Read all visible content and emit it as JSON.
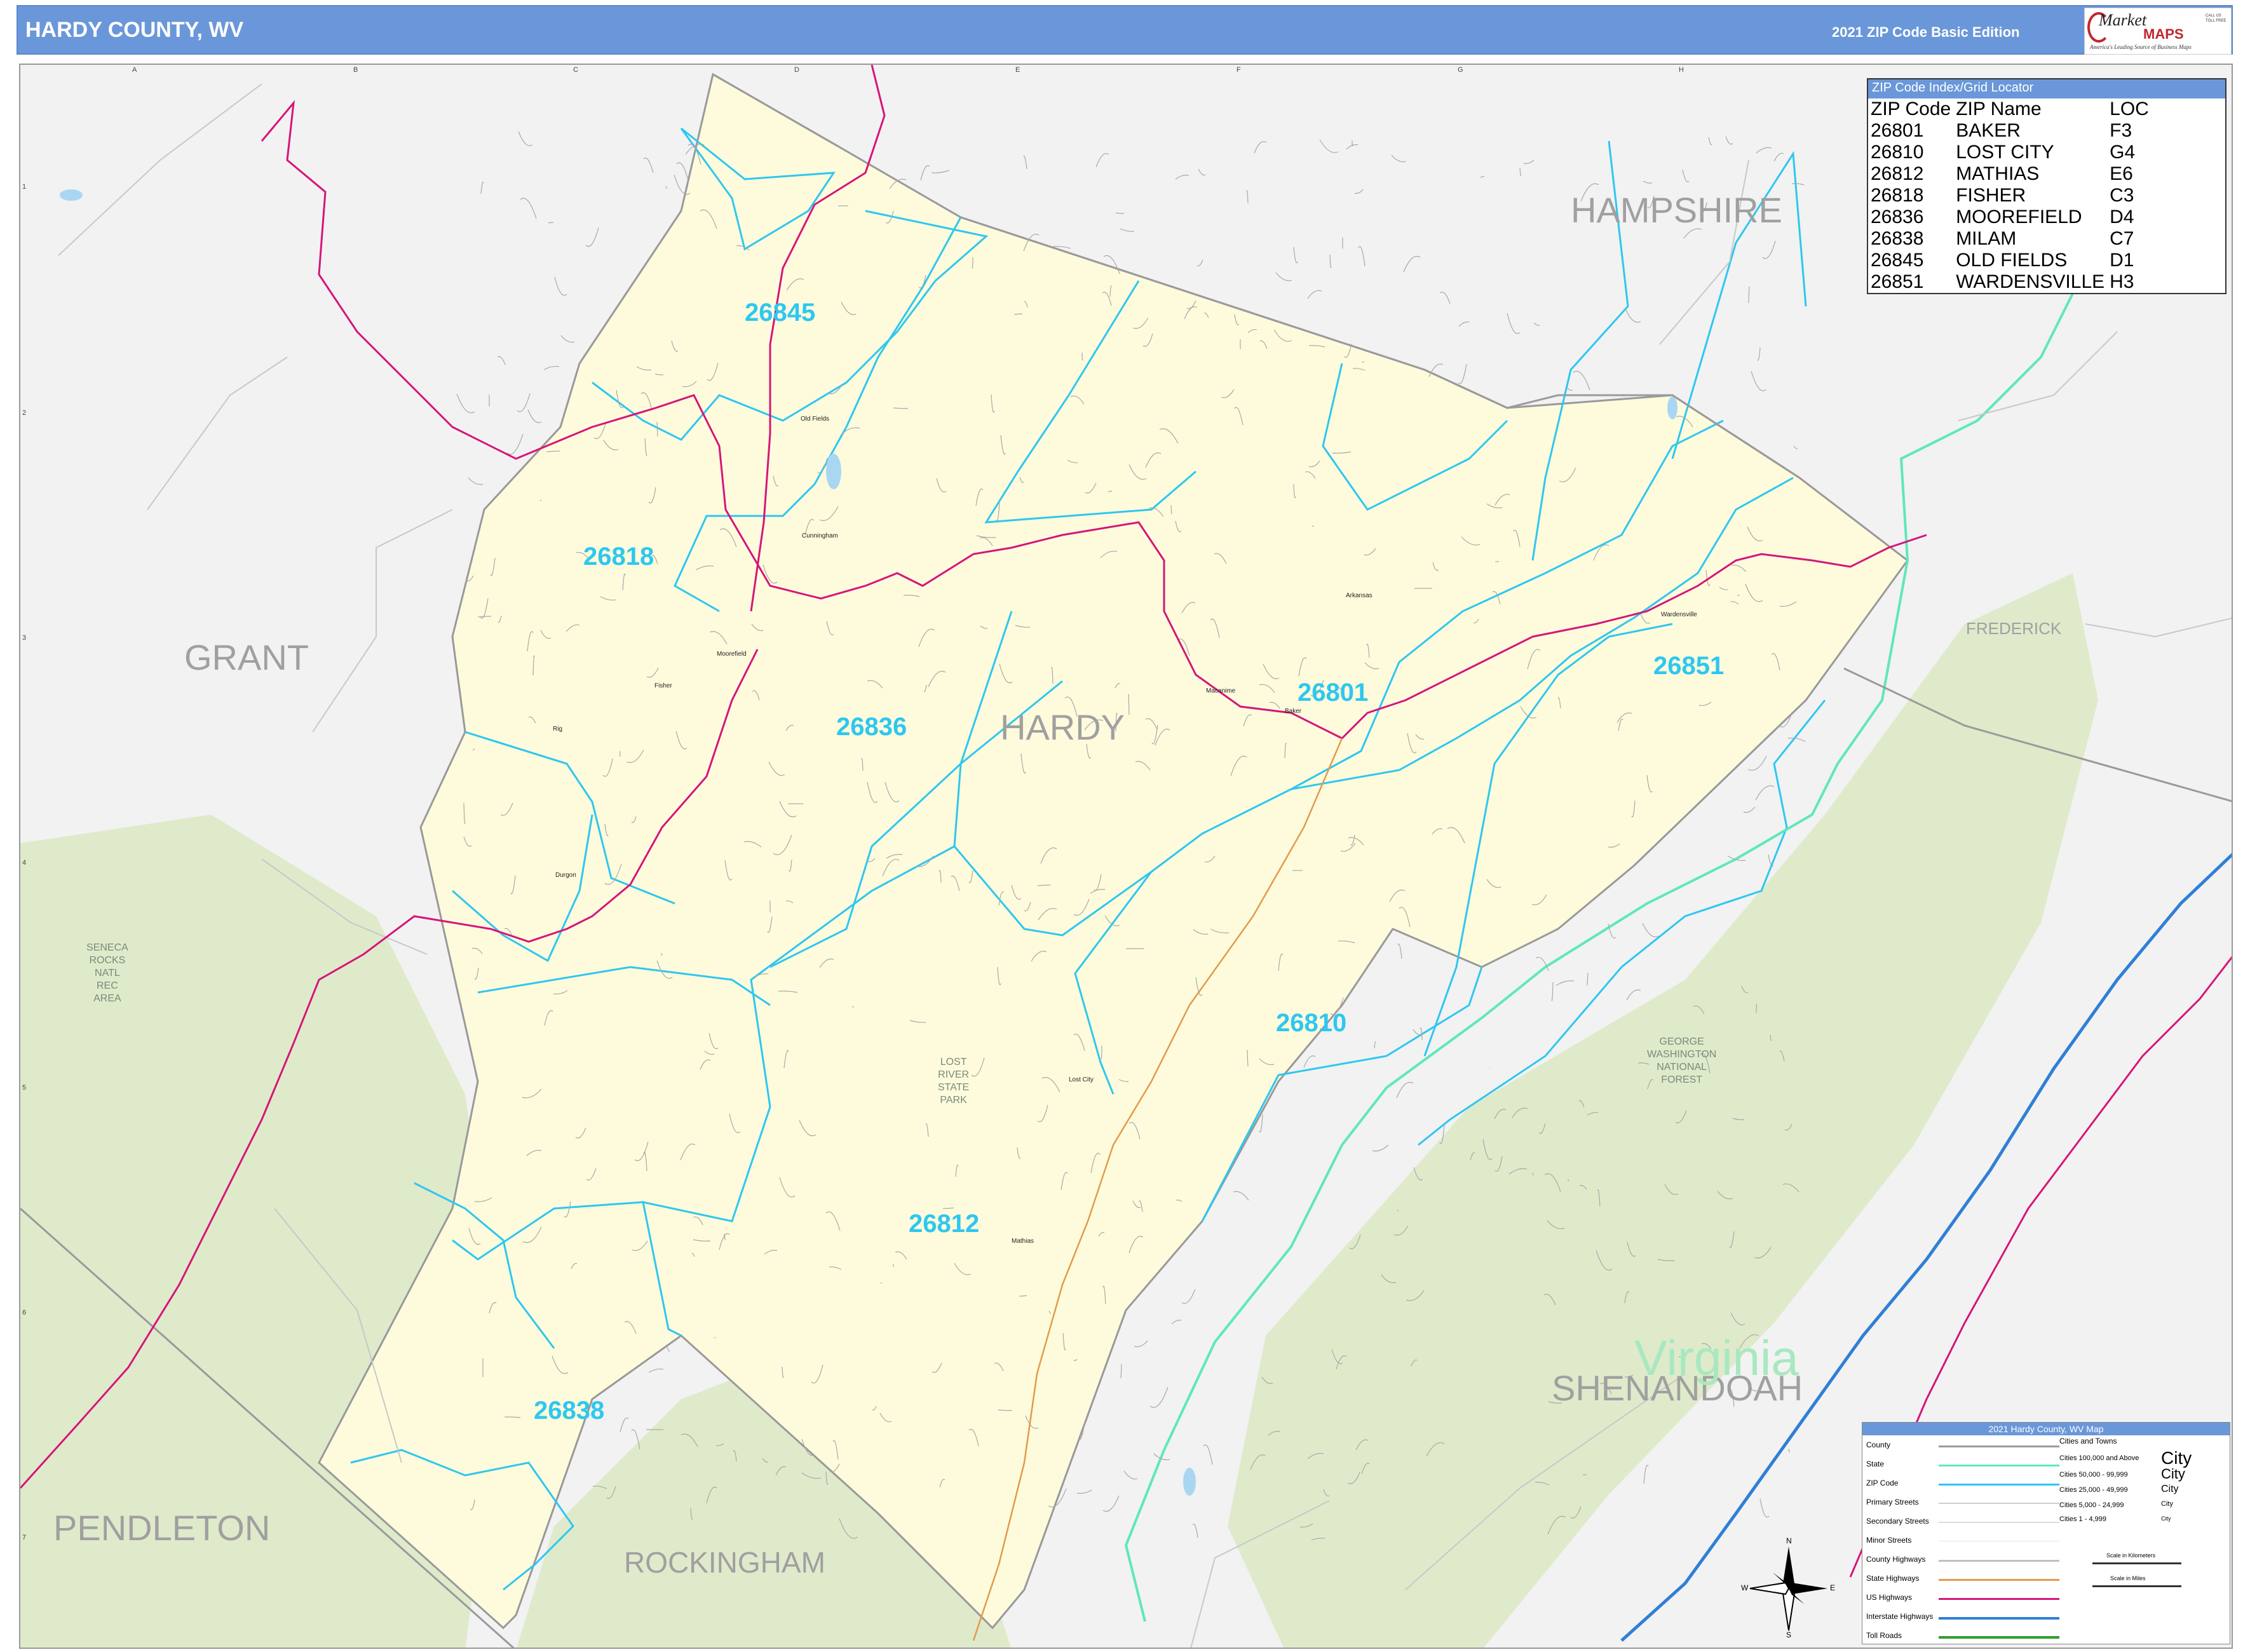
{
  "header": {
    "title": "HARDY COUNTY, WV",
    "edition": "2021 ZIP Code Basic Edition",
    "logo_market": "Market",
    "logo_maps": "MAPS",
    "logo_tagline": "America's Leading Source of Business Maps",
    "logo_call": "CALL US TOLL FREE"
  },
  "grid": {
    "columns": [
      "A",
      "B",
      "C",
      "D",
      "E",
      "F",
      "G",
      "H"
    ],
    "rows": [
      "1",
      "2",
      "3",
      "4",
      "5",
      "6",
      "7"
    ]
  },
  "zip_index": {
    "title": "ZIP Code Index/Grid Locator",
    "headers": [
      "ZIP Code",
      "ZIP Name",
      "LOC"
    ],
    "rows": [
      [
        "26801",
        "BAKER",
        "F3"
      ],
      [
        "26810",
        "LOST CITY",
        "G4"
      ],
      [
        "26812",
        "MATHIAS",
        "E6"
      ],
      [
        "26818",
        "FISHER",
        "C3"
      ],
      [
        "26836",
        "MOOREFIELD",
        "D4"
      ],
      [
        "26838",
        "MILAM",
        "C7"
      ],
      [
        "26845",
        "OLD FIELDS",
        "D1"
      ],
      [
        "26851",
        "WARDENSVILLE",
        "H3"
      ]
    ]
  },
  "labels": {
    "counties": {
      "hampshire": "HAMPSHIRE",
      "grant": "GRANT",
      "hardy": "HARDY",
      "pendleton": "PENDLETON",
      "rockingham": "ROCKINGHAM",
      "shenandoah": "SHENANDOAH",
      "frederick": "FREDERICK"
    },
    "state": "Virginia",
    "zips": {
      "z26845": "26845",
      "z26818": "26818",
      "z26836": "26836",
      "z26801": "26801",
      "z26851": "26851",
      "z26810": "26810",
      "z26812": "26812",
      "z26838": "26838"
    },
    "parks": {
      "seneca": [
        "SENECA",
        "ROCKS",
        "NATL",
        "REC",
        "AREA"
      ],
      "lost_river": [
        "LOST",
        "RIVER",
        "STATE",
        "PARK"
      ],
      "gw_forest": [
        "GEORGE",
        "WASHINGTON",
        "NATIONAL",
        "FOREST"
      ]
    },
    "towns": {
      "old_fields": "Old Fields",
      "cunningham": "Cunningham",
      "moorefield": "Moorefield",
      "fisher": "Fisher",
      "rig": "Rig",
      "durgon": "Durgon",
      "lost_city": "Lost City",
      "mathias": "Mathias",
      "wardensville": "Wardensville",
      "baker": "Baker",
      "mcclaughlin": "Macanime",
      "arkansas": "Arkansas"
    }
  },
  "legend": {
    "title": "2021 Hardy County, WV Map",
    "rows": [
      "County",
      "State",
      "ZIP Code",
      "Primary Streets",
      "Secondary Streets",
      "Minor Streets",
      "County Highways",
      "State Highways",
      "US Highways",
      "Interstate Highways",
      "Toll Roads"
    ],
    "cities_title": "Cities and Towns",
    "cities": [
      "Cities 100,000 and Above",
      "Cities 50,000 - 99,999",
      "Cities 25,000 - 49,999",
      "Cities 5,000 - 24,999",
      "Cities 1 - 4,999"
    ],
    "city_samples": [
      "City",
      "City",
      "City",
      "City",
      "City"
    ],
    "scale_km": "Scale in Kilometers",
    "scale_mi": "Scale in Miles"
  },
  "compass": {
    "n": "N",
    "s": "S",
    "e": "E",
    "w": "W"
  },
  "colors": {
    "header": "#6a97d9",
    "county_fill": "#fdfbdc",
    "zip_line": "#2ec7f0",
    "us_highway": "#d6157a",
    "forest": "#dfeacb",
    "state_border": "#5fe8b8",
    "interstate": "#2f7fd6"
  }
}
